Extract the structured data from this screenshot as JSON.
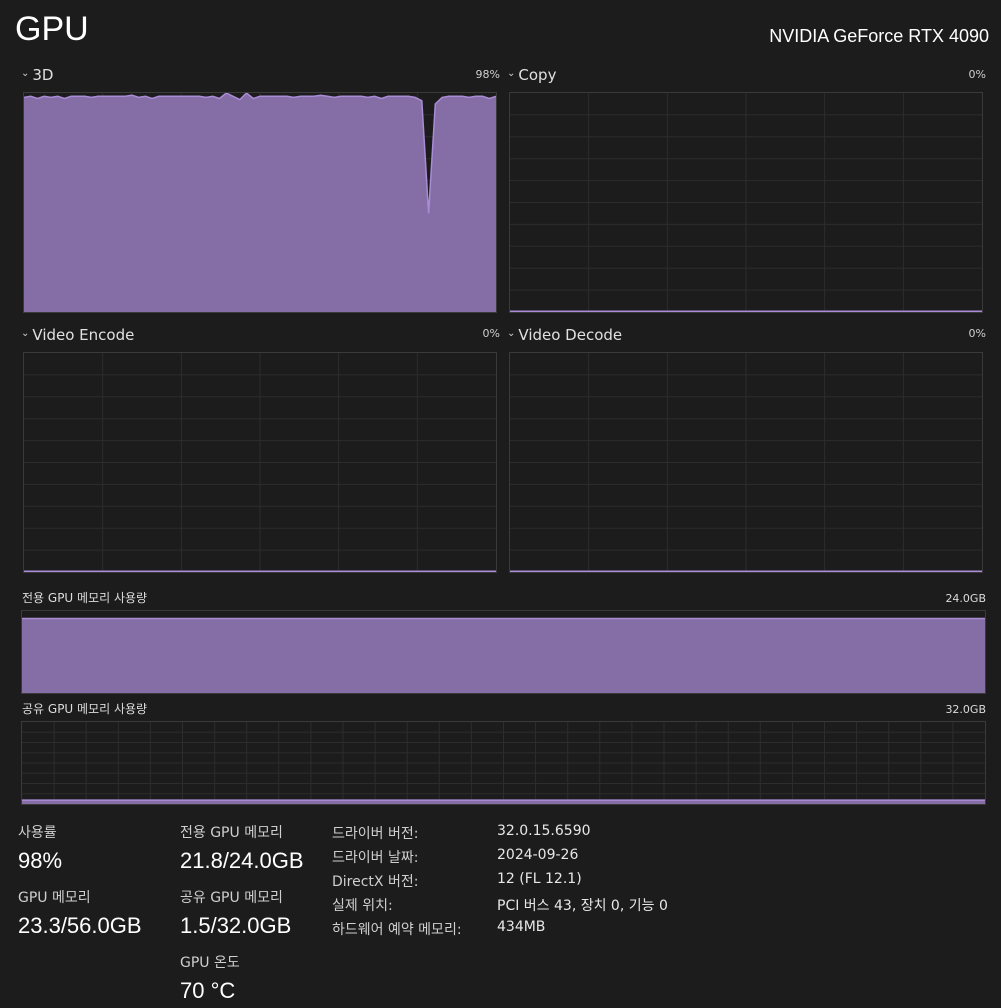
{
  "header": {
    "title": "GPU",
    "device": "NVIDIA GeForce RTX 4090"
  },
  "engines": [
    {
      "name": "3D",
      "percent": "98%",
      "usage": [
        0.98,
        0.985,
        0.975,
        0.985,
        0.98,
        0.985,
        0.975,
        0.985,
        0.985,
        0.985,
        0.98,
        0.985,
        0.985,
        0.985,
        0.985,
        0.985,
        0.99,
        0.98,
        0.985,
        0.975,
        0.985,
        0.985,
        0.985,
        0.985,
        0.985,
        0.985,
        0.985,
        0.98,
        0.985,
        0.975,
        1.0,
        0.985,
        0.97,
        1.0,
        0.975,
        0.985,
        0.985,
        0.985,
        0.985,
        0.985,
        0.98,
        0.985,
        0.985,
        0.985,
        0.99,
        0.985,
        0.98,
        0.985,
        0.985,
        0.985,
        0.985,
        0.98,
        0.985,
        0.975,
        0.985,
        0.985,
        0.985,
        0.985,
        0.98,
        0.965,
        0.45,
        0.95,
        0.98,
        0.985,
        0.985,
        0.985,
        0.98,
        0.985,
        0.985,
        0.975,
        0.985
      ]
    },
    {
      "name": "Copy",
      "percent": "0%",
      "usage": []
    },
    {
      "name": "Video Encode",
      "percent": "0%",
      "usage": []
    },
    {
      "name": "Video Decode",
      "percent": "0%",
      "usage": []
    }
  ],
  "dedicated_memory": {
    "label": "전용 GPU 메모리 사용량",
    "capacity": "24.0GB",
    "usage_fraction": 0.908
  },
  "shared_memory": {
    "label": "공유 GPU 메모리 사용량",
    "capacity": "32.0GB",
    "usage_fraction": 0.047
  },
  "stats": {
    "utilization_label": "사용률",
    "utilization_value": "98%",
    "gpu_memory_label": "GPU 메모리",
    "gpu_memory_value": "23.3/56.0GB",
    "dedicated_label": "전용 GPU 메모리",
    "dedicated_value": "21.8/24.0GB",
    "shared_label": "공유 GPU 메모리",
    "shared_value": "1.5/32.0GB",
    "temp_label": "GPU 온도",
    "temp_value": "70 °C"
  },
  "info": [
    {
      "key": "드라이버 버전:",
      "value": "32.0.15.6590"
    },
    {
      "key": "드라이버 날짜:",
      "value": "2024-09-26"
    },
    {
      "key": "DirectX 버전:",
      "value": "12 (FL 12.1)"
    },
    {
      "key": "실제 위치:",
      "value": "PCI 버스 43, 장치 0, 기능 0"
    },
    {
      "key": "하드웨어 예약 메모리:",
      "value": "434MB"
    }
  ],
  "colors": {
    "accent_fill": "#8a73ad",
    "accent_line": "#a98bd6",
    "grid": "#2d2d2d",
    "background": "#1c1c1c"
  }
}
